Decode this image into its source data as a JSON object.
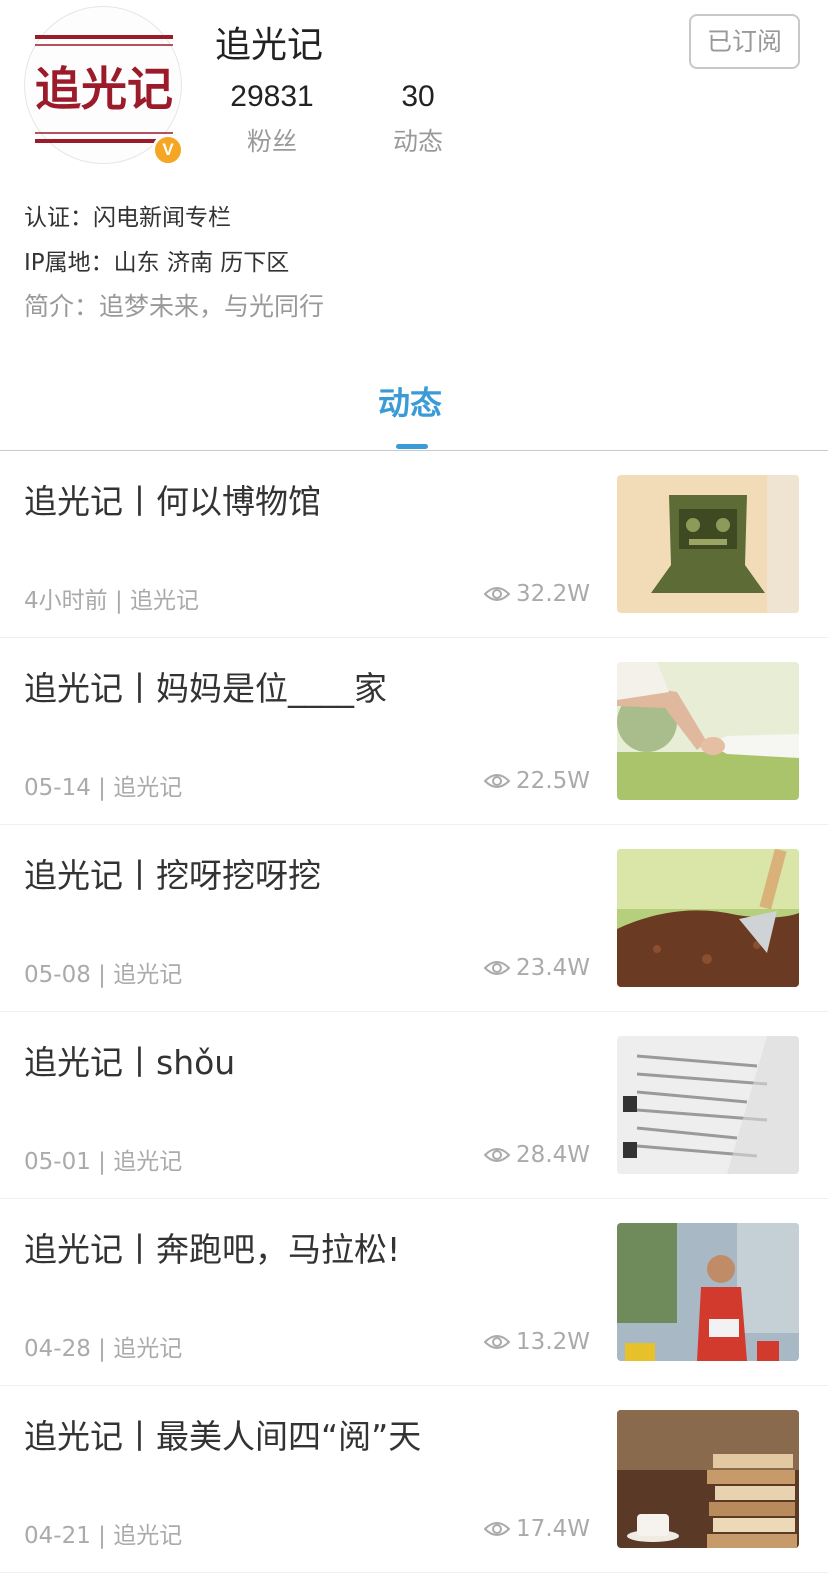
{
  "profile": {
    "name": "追光记",
    "avatar_text": "追光记",
    "verified_badge": "V",
    "subscribe_label": "已订阅",
    "stats": [
      {
        "value": "29831",
        "label": "粉丝"
      },
      {
        "value": "30",
        "label": "动态"
      }
    ],
    "certification": "认证：闪电新闻专栏",
    "ip_location": "IP属地：山东 济南 历下区",
    "bio": "简介：追梦未来，与光同行"
  },
  "tabs": {
    "active_label": "动态"
  },
  "feed": [
    {
      "title": "追光记丨何以博物馆",
      "time": "4小时前",
      "source": "追光记",
      "views": "32.2W",
      "thumb_icon": "bronze-mask-photo"
    },
    {
      "title": "追光记丨妈妈是位____家",
      "time": "05-14",
      "source": "追光记",
      "views": "22.5W",
      "thumb_icon": "holding-hands-photo"
    },
    {
      "title": "追光记丨挖呀挖呀挖",
      "time": "05-08",
      "source": "追光记",
      "views": "23.4W",
      "thumb_icon": "garden-trowel-photo"
    },
    {
      "title": "追光记丨shǒu",
      "time": "05-01",
      "source": "追光记",
      "views": "28.4W",
      "thumb_icon": "dictionary-page-photo"
    },
    {
      "title": "追光记丨奔跑吧，马拉松!",
      "time": "04-28",
      "source": "追光记",
      "views": "13.2W",
      "thumb_icon": "marathon-runner-photo"
    },
    {
      "title": "追光记丨最美人间四“阅”天",
      "time": "04-21",
      "source": "追光记",
      "views": "17.4W",
      "thumb_icon": "book-stack-photo"
    }
  ],
  "colors": {
    "accent": "#3a9bd6",
    "brand_red": "#9b1b2a",
    "badge": "#f5a623"
  }
}
